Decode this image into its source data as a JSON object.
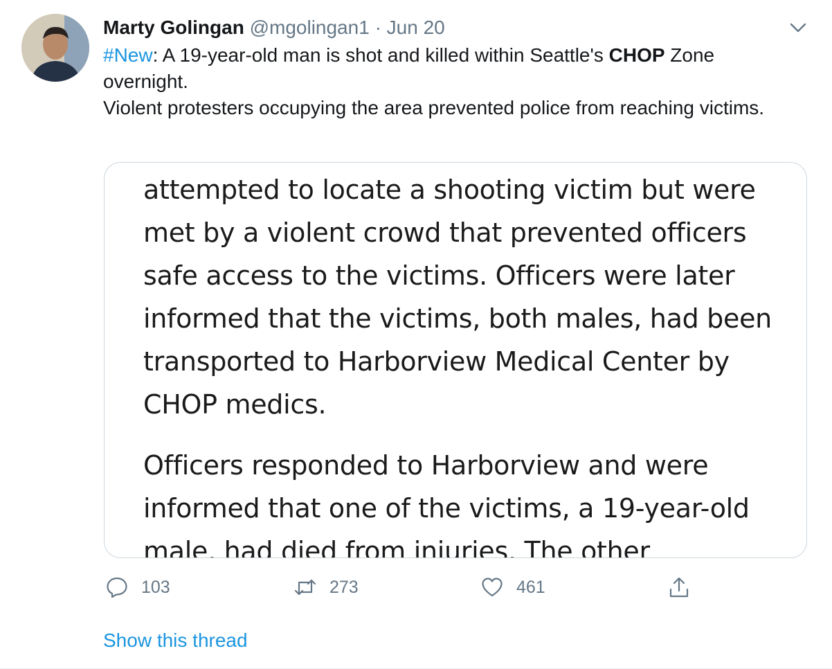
{
  "tweet": {
    "author_name": "Marty Golingan",
    "author_handle": "@mgolingan1",
    "separator": "·",
    "date": "Jun 20",
    "text": {
      "hashtag": "#New",
      "line1_a": ": A 19-year-old man is shot and killed within Seattle's ",
      "line1_bold": "CHOP",
      "line1_b": " Zone overnight.",
      "line2": "Violent protesters occupying the area prevented police from reaching victims."
    },
    "card": {
      "paragraph1": "attempted to locate a shooting victim but were met by a violent crowd that prevented officers safe access to the victims. Officers were later informed that the victims, both males, had been transported to Harborview Medical Center by CHOP medics.",
      "paragraph2": "Officers responded to Harborview and were informed that one of the victims, a 19-year-old male, had died from injuries. The other"
    },
    "actions": {
      "reply_count": "103",
      "retweet_count": "273",
      "like_count": "461"
    },
    "show_thread": "Show this thread"
  },
  "icons": [
    "avatar",
    "chevron-down-icon",
    "reply-icon",
    "retweet-icon",
    "like-icon",
    "share-icon"
  ],
  "colors": {
    "link": "#1b95e0",
    "secondary": "#657786",
    "border": "#ccd6dd"
  }
}
